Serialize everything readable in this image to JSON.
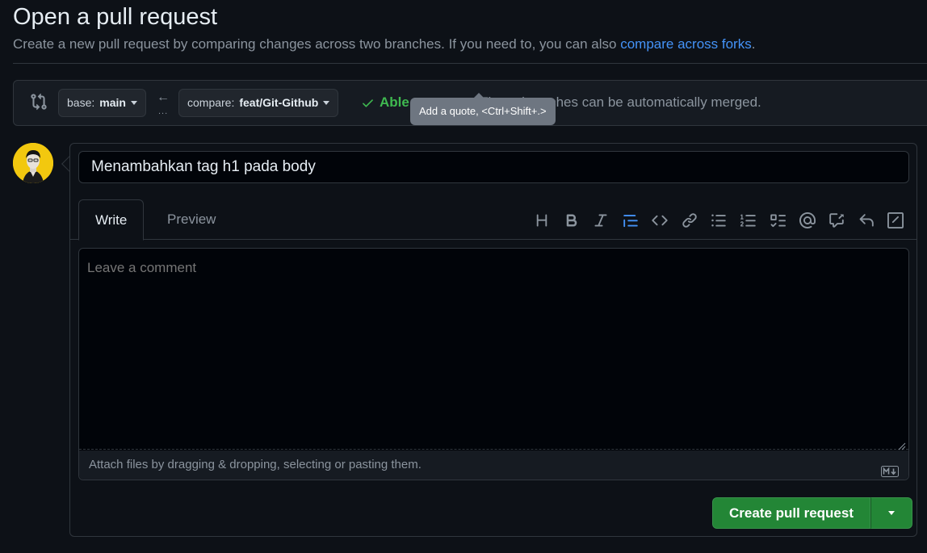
{
  "header": {
    "title": "Open a pull request",
    "subtitle": "Create a new pull request by comparing changes across two branches. If you need to, you can also ",
    "subtitle_link": "compare across forks",
    "subtitle_end": "."
  },
  "range": {
    "base_label": "base:",
    "base_branch": "main",
    "compare_label": "compare:",
    "compare_branch": "feat/Git-Github",
    "dots": "...",
    "merge_ok": "Able to merge.",
    "merge_msg": "These branches can be automatically merged."
  },
  "form": {
    "title_value": "Menambahkan tag h1 pada body",
    "tabs": [
      "Write",
      "Preview"
    ],
    "comment_placeholder": "Leave a comment",
    "attach_text": "Attach files by dragging & dropping, selecting or pasting them.",
    "tooltip": "Add a quote, <Ctrl+Shift+.>",
    "toolbar_icons": [
      "heading-icon",
      "bold-icon",
      "italic-icon",
      "quote-icon",
      "code-icon",
      "link-icon",
      "unordered-list-icon",
      "ordered-list-icon",
      "task-list-icon",
      "mention-icon",
      "cross-reference-icon",
      "reply-icon",
      "slash-command-icon"
    ]
  },
  "actions": {
    "create_label": "Create pull request"
  },
  "colors": {
    "background": "#0d1117",
    "accent_link": "#4493f8",
    "success": "#3fb950",
    "button_green": "#238636",
    "active_tool": "#4493f8"
  }
}
